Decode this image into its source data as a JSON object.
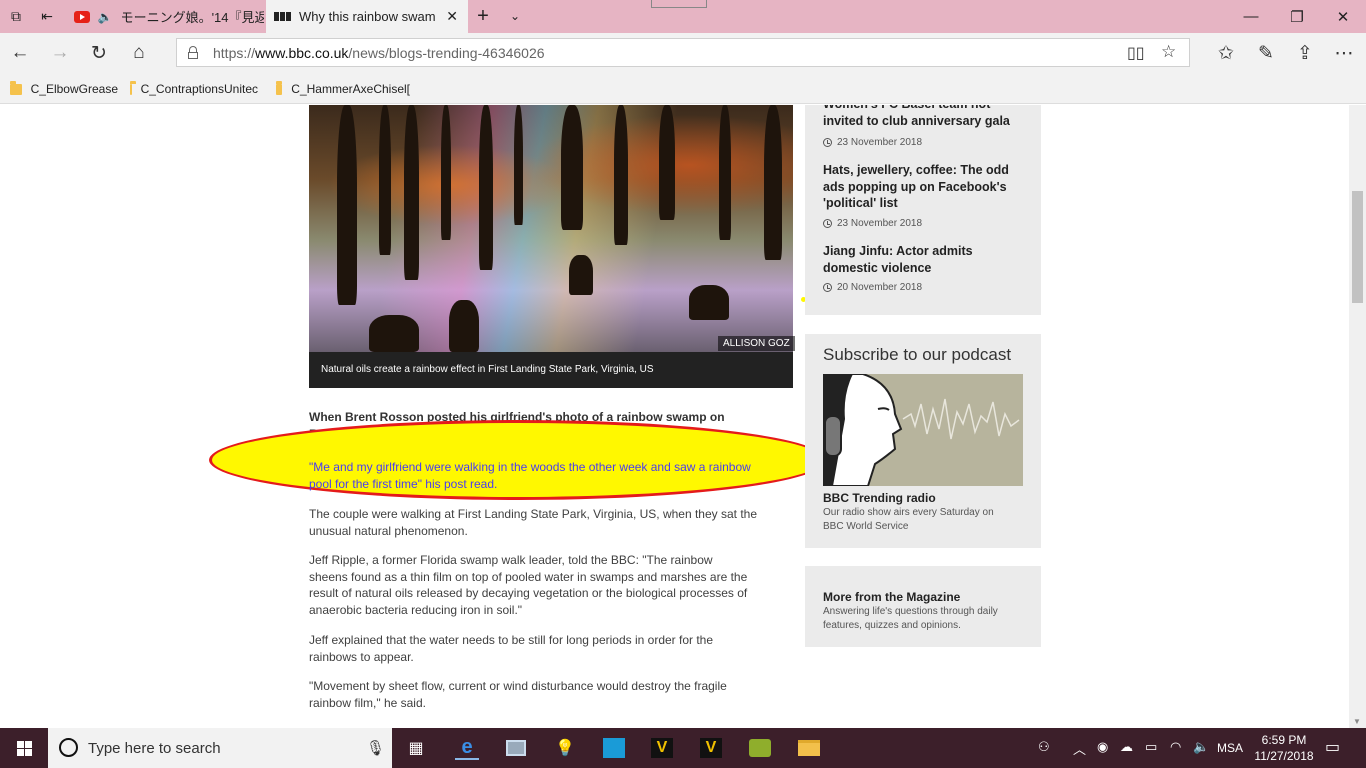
{
  "browser": {
    "tabs": [
      {
        "title": "モーニング娘。'14『見返",
        "icon": "youtube-icon",
        "audio": true
      },
      {
        "title": "Why this rainbow swam",
        "icon": "bbc-icon",
        "active": true
      }
    ],
    "url_prefix": "https://",
    "url_domain": "www.bbc.co.uk",
    "url_path": "/news/blogs-trending-46346026",
    "favorites": [
      "C_ElbowGrease",
      "C_ContraptionsUnitec",
      "C_HammerAxeChisel["
    ]
  },
  "article": {
    "photo_credit": "ALLISON GOZ",
    "caption": "Natural oils create a rainbow effect in First Landing State Park, Virginia, US",
    "lead": "When Brent Rosson posted his girlfriend's photo of a rainbow swamp on Reddit, it received more than 120,000 upvotes in 24 hours.",
    "quote": "\"Me and my girlfriend were walking in the woods the other week and saw a rainbow pool for the first time\" his post read.",
    "p1": "The couple were walking at First Landing State Park, Virginia, US, when they sat the unusual natural phenomenon.",
    "p2": "Jeff Ripple, a former Florida swamp walk leader, told the BBC: \"The rainbow sheens found as a thin film on top of pooled water in swamps and marshes are the result of natural oils released by decaying vegetation or the biological processes of anaerobic bacteria reducing iron in soil.\"",
    "p3": "Jeff explained that the water needs to be still for long periods in order for the rainbows to appear.",
    "p4": "\"Movement by sheet flow, current or wind disturbance would destroy the fragile rainbow film,\" he said."
  },
  "sidebar": {
    "related": [
      {
        "title": "Women's FC Basel team not invited to club anniversary gala",
        "date": "23 November 2018"
      },
      {
        "title": "Hats, jewellery, coffee: The odd ads popping up on Facebook's 'political' list",
        "date": "23 November 2018"
      },
      {
        "title": "Jiang Jinfu: Actor admits domestic violence",
        "date": "20 November 2018"
      }
    ],
    "podcast_heading": "Subscribe to our podcast",
    "podcast_title": "BBC Trending radio",
    "podcast_desc": "Our radio show airs every Saturday on BBC World Service",
    "magazine_title": "More from the Magazine",
    "magazine_desc": "Answering life's questions through daily features, quizzes and opinions."
  },
  "taskbar": {
    "search_placeholder": "Type here to search",
    "language": "MSA",
    "time": "6:59 PM",
    "date": "11/27/2018"
  }
}
